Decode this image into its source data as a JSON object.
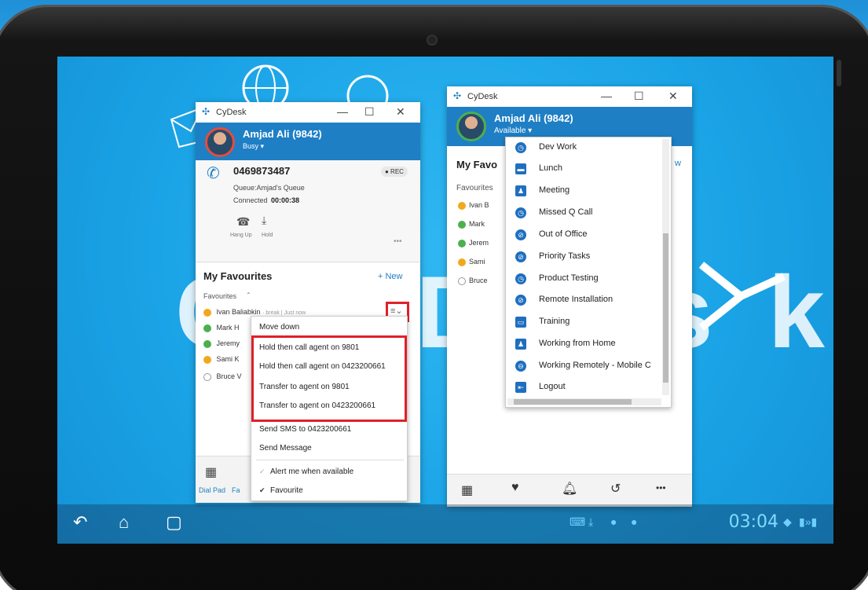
{
  "nav": {
    "clock": "03:04",
    "back_icon": "↶",
    "home_icon": "⌂",
    "recent_icon": "▢"
  },
  "bg": {
    "text": "CyDesk"
  },
  "left_window": {
    "title": "CyDesk",
    "user_name": "Amjad Ali (9842)",
    "user_status": "Busy ▾",
    "call": {
      "number": "0469873487",
      "rec_label": "● REC",
      "queue": "Queue:Amjad's Queue",
      "connected_label": "Connected",
      "duration": "00:00:38",
      "hangup_label": "Hang Up",
      "hold_label": "Hold"
    },
    "favourites": {
      "title": "My Favourites",
      "new_label": "+ New",
      "group_label": "Favourites",
      "items": [
        {
          "name": "Ivan Baliabkin",
          "note": "· break | Just now"
        },
        {
          "name": "Mark H"
        },
        {
          "name": "Jeremy"
        },
        {
          "name": "Sami K"
        },
        {
          "name": "Bruce V"
        }
      ]
    },
    "context_menu": {
      "items": [
        "Move down",
        "Hold then call agent on 9801",
        "Hold then call agent on 0423200661",
        "Transfer to agent on 9801",
        "Transfer to agent on 0423200661",
        "Send SMS to 0423200661",
        "Send Message",
        "Alert me when available",
        "Favourite"
      ]
    },
    "footer": {
      "dialpad_label": "Dial Pad",
      "fav_label": "Fa"
    }
  },
  "right_window": {
    "title": "CyDesk",
    "user_name": "Amjad Ali (9842)",
    "user_status": "Available ▾",
    "favourites_title": "My Favo",
    "new_label": "w",
    "group_label": "Favourites",
    "items": [
      "Ivan B",
      "Mark",
      "Jerem",
      "Sami",
      "Bruce"
    ],
    "status_menu": [
      "Dev Work",
      "Lunch",
      "Meeting",
      "Missed Q Call",
      "Out of Office",
      "Priority Tasks",
      "Product Testing",
      "Remote Installation",
      "Training",
      "Working from Home",
      "Working Remotely - Mobile C",
      "Logout"
    ]
  }
}
